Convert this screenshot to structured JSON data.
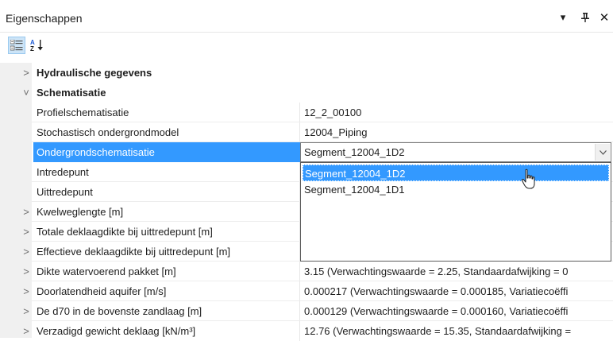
{
  "panel": {
    "title": "Eigenschappen",
    "pin_glyph": "ᴪ",
    "close_glyph": "✕",
    "dropdown_glyph": "▾"
  },
  "toolbar": {
    "categorized_label": "Categorized",
    "alphabetical_label": "A-Z"
  },
  "rows": [
    {
      "kind": "category",
      "expander": ">",
      "name": "Hydraulische gegevens"
    },
    {
      "kind": "category",
      "expander": "˅",
      "name": "Schematisatie"
    },
    {
      "kind": "property",
      "name": "Profielschematisatie",
      "value": "12_2_00100"
    },
    {
      "kind": "property",
      "name": "Stochastisch ondergrondmodel",
      "value": "12004_Piping"
    },
    {
      "kind": "property",
      "name": "Ondergrondschematisatie",
      "value": "Segment_12004_1D2",
      "selected": true
    },
    {
      "kind": "property",
      "name": "Intredepunt",
      "value": ""
    },
    {
      "kind": "property",
      "name": "Uittredepunt",
      "value": ""
    },
    {
      "kind": "expandable",
      "expander": ">",
      "name": "Kwelweglengte [m]",
      "value": ""
    },
    {
      "kind": "expandable",
      "expander": ">",
      "name": "Totale deklaagdikte bij uittredepunt [m]",
      "value": ""
    },
    {
      "kind": "expandable",
      "expander": ">",
      "name": "Effectieve deklaagdikte bij uittredepunt [m]",
      "value": ""
    },
    {
      "kind": "expandable",
      "expander": ">",
      "name": "Dikte watervoerend pakket [m]",
      "value": "3.15 (Verwachtingswaarde = 2.25, Standaardafwijking = 0"
    },
    {
      "kind": "expandable",
      "expander": ">",
      "name": "Doorlatendheid aquifer [m/s]",
      "value": "0.000217 (Verwachtingswaarde = 0.000185, Variatiecoëffi"
    },
    {
      "kind": "expandable",
      "expander": ">",
      "name": "De d70 in de bovenste zandlaag [m]",
      "value": "0.000129 (Verwachtingswaarde = 0.000160, Variatiecoëffi"
    },
    {
      "kind": "expandable",
      "expander": ">",
      "name": "Verzadigd gewicht deklaag [kN/m³]",
      "value": "12.76 (Verwachtingswaarde = 15.35, Standaardafwijking ="
    }
  ],
  "dropdown": {
    "options": [
      "Segment_12004_1D2",
      "Segment_12004_1D1"
    ],
    "highlighted_index": 0
  },
  "colors": {
    "selection": "#3399ff",
    "gutter": "#f0f0f0"
  }
}
